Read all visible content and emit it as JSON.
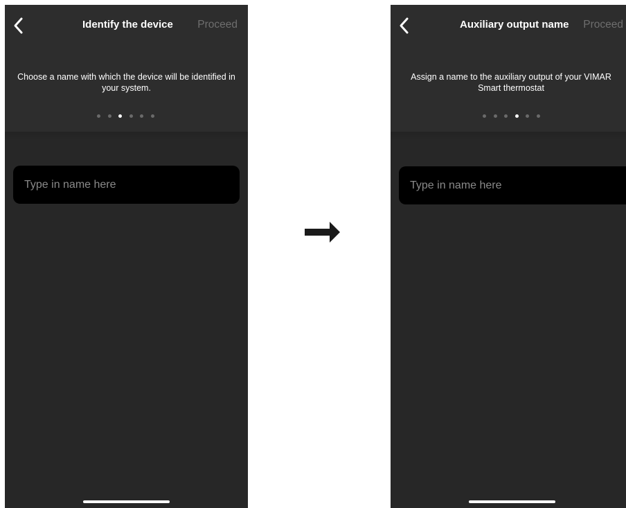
{
  "screens": [
    {
      "title": "Identify the device",
      "proceed_label": "Proceed",
      "description": "Choose a name with which the device will be identified in your system.",
      "input_placeholder": "Type in name here",
      "page_indicator": {
        "total": 6,
        "current": 3
      }
    },
    {
      "title": "Auxiliary output name",
      "proceed_label": "Proceed",
      "description": "Assign a name to the auxiliary output of your VIMAR Smart thermostat",
      "input_placeholder": "Type in name here",
      "page_indicator": {
        "total": 6,
        "current": 4
      }
    }
  ],
  "icons": {
    "back": "chevron-left-icon",
    "transition": "arrow-right-icon"
  },
  "colors": {
    "background": "#272727",
    "header": "#2d2d2d",
    "input_background": "#000000",
    "proceed_disabled": "#6e6e6e",
    "dot_inactive": "#6a6a6a",
    "dot_active": "#ffffff"
  }
}
